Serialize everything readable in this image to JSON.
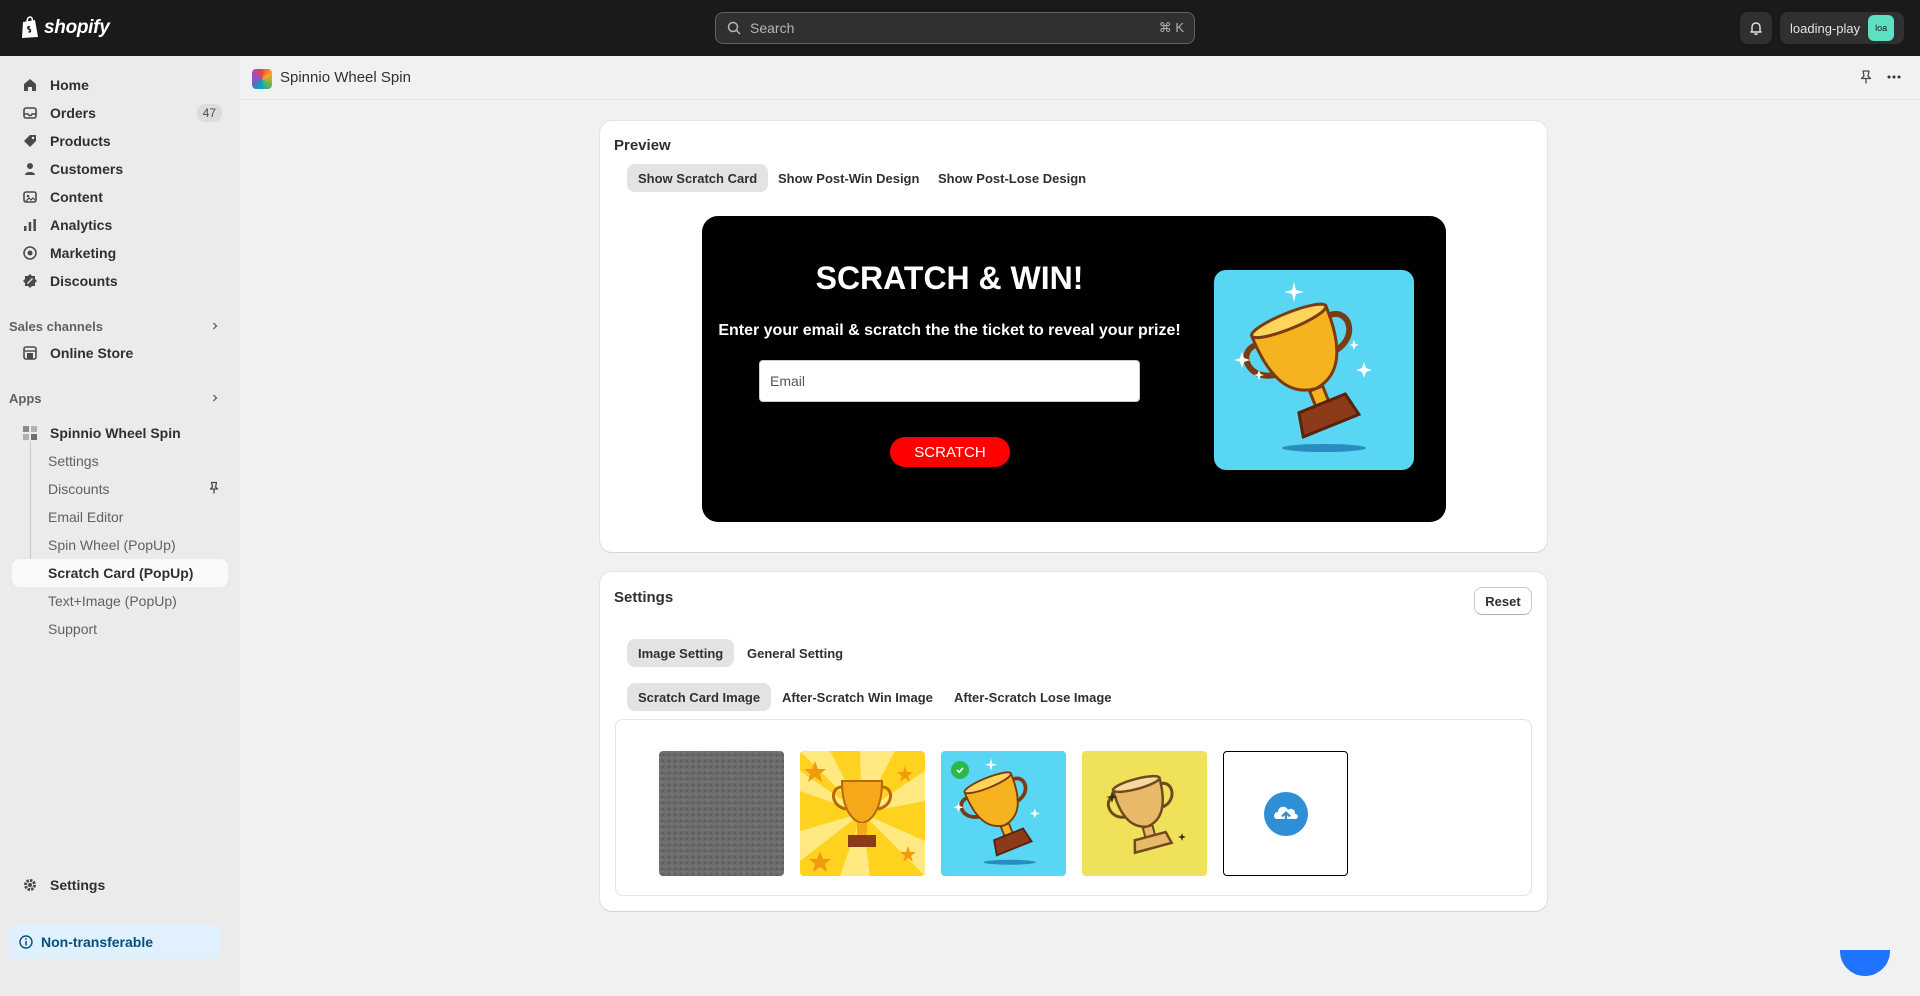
{
  "topbar": {
    "logo_text": "shopify",
    "search_placeholder": "Search",
    "search_shortcut": "⌘ K",
    "account_name": "loading-play",
    "avatar_initials": "loa",
    "icons": [
      "shopify-bag-icon",
      "search-icon",
      "bell-icon"
    ]
  },
  "sidebar": {
    "items": [
      {
        "label": "Home",
        "icon": "home-icon"
      },
      {
        "label": "Orders",
        "icon": "orders-icon",
        "badge": "47"
      },
      {
        "label": "Products",
        "icon": "tag-icon"
      },
      {
        "label": "Customers",
        "icon": "person-icon"
      },
      {
        "label": "Content",
        "icon": "content-icon"
      },
      {
        "label": "Analytics",
        "icon": "chart-icon"
      },
      {
        "label": "Marketing",
        "icon": "target-icon"
      },
      {
        "label": "Discounts",
        "icon": "discount-icon"
      }
    ],
    "sales_channels_label": "Sales channels",
    "online_store_label": "Online Store",
    "apps_label": "Apps",
    "app_name": "Spinnio Wheel Spin",
    "app_sub_items": [
      {
        "label": "Settings"
      },
      {
        "label": "Discounts"
      },
      {
        "label": "Email Editor"
      },
      {
        "label": "Spin Wheel (PopUp)"
      },
      {
        "label": "Scratch Card (PopUp)",
        "active": true
      },
      {
        "label": "Text+Image (PopUp)"
      },
      {
        "label": "Support"
      }
    ],
    "settings_label": "Settings",
    "non_transferable_label": "Non-transferable"
  },
  "page": {
    "title": "Spinnio Wheel Spin"
  },
  "preview": {
    "title": "Preview",
    "tabs": [
      {
        "label": "Show Scratch Card",
        "active": true
      },
      {
        "label": "Show Post-Win Design"
      },
      {
        "label": "Show Post-Lose Design"
      }
    ],
    "popup": {
      "heading": "SCRATCH & WIN!",
      "subheading": "Enter your email & scratch the the ticket to reveal your prize!",
      "email_placeholder": "Email",
      "button_label": "SCRATCH",
      "button_color": "#ff0000",
      "background_color": "#000000",
      "image_bg_color": "#5ad6f5"
    }
  },
  "settings": {
    "title": "Settings",
    "reset_label": "Reset",
    "main_tabs": [
      {
        "label": "Image Setting",
        "active": true
      },
      {
        "label": "General Setting"
      }
    ],
    "image_tabs": [
      {
        "label": "Scratch Card Image",
        "active": true
      },
      {
        "label": "After-Scratch Win Image"
      },
      {
        "label": "After-Scratch Lose Image"
      }
    ],
    "images": [
      {
        "name": "gray-texture"
      },
      {
        "name": "trophy-yellow-burst"
      },
      {
        "name": "trophy-blue-sparkles",
        "selected": true
      },
      {
        "name": "trophy-gold-on-yellow"
      },
      {
        "name": "upload-cloud-icon"
      }
    ]
  }
}
